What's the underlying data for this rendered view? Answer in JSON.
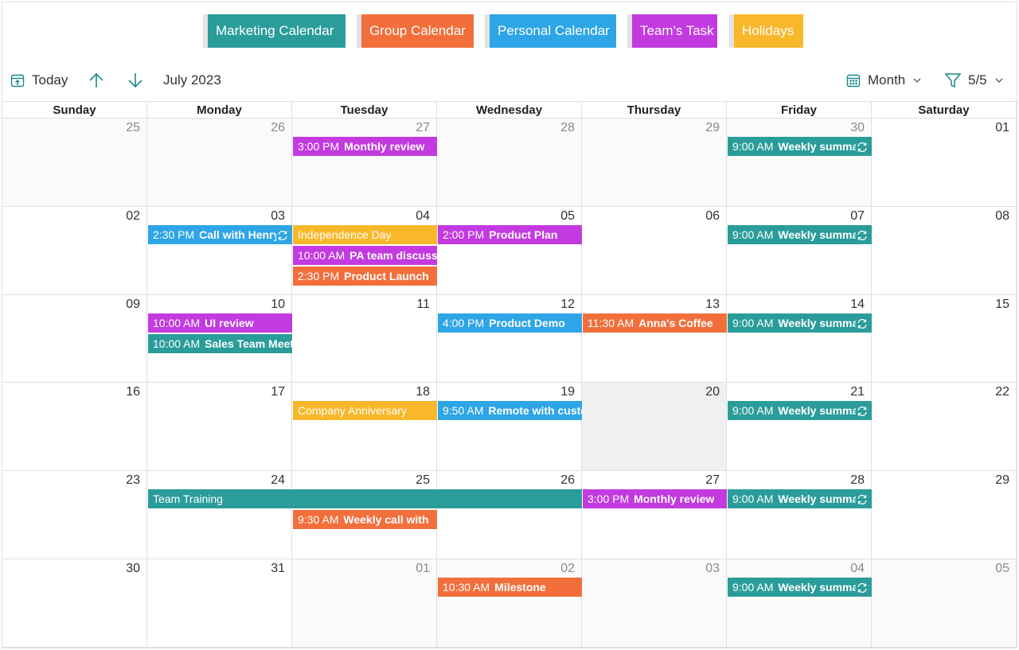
{
  "colors": {
    "marketing": "#2a9d9b",
    "group": "#f26f3c",
    "personal": "#2ea5e6",
    "team": "#c23ae0",
    "holidays": "#f9b72a",
    "accent": "#1a8a86"
  },
  "legend": [
    {
      "label": "Marketing Calendar",
      "color": "#2a9d9b"
    },
    {
      "label": "Group Calendar",
      "color": "#f26f3c"
    },
    {
      "label": "Personal Calendar",
      "color": "#2ea5e6"
    },
    {
      "label": "Team's Task",
      "color": "#c23ae0"
    },
    {
      "label": "Holidays",
      "color": "#f9b72a"
    }
  ],
  "toolbar": {
    "today_label": "Today",
    "period_label": "July 2023",
    "view_label": "Month",
    "filter_label": "5/5"
  },
  "weekdays": [
    "Sunday",
    "Monday",
    "Tuesday",
    "Wednesday",
    "Thursday",
    "Friday",
    "Saturday"
  ],
  "weeks": [
    [
      {
        "d": "25",
        "o": true
      },
      {
        "d": "26",
        "o": true
      },
      {
        "d": "27",
        "o": true
      },
      {
        "d": "28",
        "o": true
      },
      {
        "d": "29",
        "o": true
      },
      {
        "d": "30",
        "o": true
      },
      {
        "d": "01"
      }
    ],
    [
      {
        "d": "02"
      },
      {
        "d": "03"
      },
      {
        "d": "04"
      },
      {
        "d": "05"
      },
      {
        "d": "06"
      },
      {
        "d": "07"
      },
      {
        "d": "08"
      }
    ],
    [
      {
        "d": "09"
      },
      {
        "d": "10"
      },
      {
        "d": "11"
      },
      {
        "d": "12"
      },
      {
        "d": "13"
      },
      {
        "d": "14"
      },
      {
        "d": "15"
      }
    ],
    [
      {
        "d": "16"
      },
      {
        "d": "17"
      },
      {
        "d": "18"
      },
      {
        "d": "19"
      },
      {
        "d": "20",
        "today": true
      },
      {
        "d": "21"
      },
      {
        "d": "22"
      }
    ],
    [
      {
        "d": "23"
      },
      {
        "d": "24"
      },
      {
        "d": "25"
      },
      {
        "d": "26"
      },
      {
        "d": "27"
      },
      {
        "d": "28"
      },
      {
        "d": "29"
      }
    ],
    [
      {
        "d": "30"
      },
      {
        "d": "31"
      },
      {
        "d": "01",
        "o": true
      },
      {
        "d": "02",
        "o": true
      },
      {
        "d": "03",
        "o": true
      },
      {
        "d": "04",
        "o": true
      },
      {
        "d": "05",
        "o": true
      }
    ]
  ],
  "events": [
    {
      "w": 0,
      "c": 2,
      "span": 1,
      "slot": 0,
      "time": "3:00 PM",
      "subject": "Monthly review",
      "cal": "team"
    },
    {
      "w": 0,
      "c": 5,
      "span": 1,
      "slot": 0,
      "time": "9:00 AM",
      "subject": "Weekly summary",
      "cal": "marketing",
      "recurring": true
    },
    {
      "w": 1,
      "c": 1,
      "span": 1,
      "slot": 0,
      "time": "2:30 PM",
      "subject": "Call with Henry",
      "cal": "personal",
      "recurring": true
    },
    {
      "w": 1,
      "c": 2,
      "span": 1,
      "slot": 0,
      "time": "",
      "subject": "Independence Day",
      "cal": "holidays"
    },
    {
      "w": 1,
      "c": 2,
      "span": 1,
      "slot": 1,
      "time": "10:00 AM",
      "subject": "PA team discussion",
      "cal": "team"
    },
    {
      "w": 1,
      "c": 2,
      "span": 1,
      "slot": 2,
      "time": "2:30 PM",
      "subject": "Product Launch",
      "cal": "group"
    },
    {
      "w": 1,
      "c": 3,
      "span": 1,
      "slot": 0,
      "time": "2:00 PM",
      "subject": "Product Plan",
      "cal": "team"
    },
    {
      "w": 1,
      "c": 5,
      "span": 1,
      "slot": 0,
      "time": "9:00 AM",
      "subject": "Weekly summary",
      "cal": "marketing",
      "recurring": true
    },
    {
      "w": 2,
      "c": 1,
      "span": 1,
      "slot": 0,
      "time": "10:00 AM",
      "subject": "UI review",
      "cal": "team"
    },
    {
      "w": 2,
      "c": 1,
      "span": 1,
      "slot": 1,
      "time": "10:00 AM",
      "subject": "Sales Team Meeting",
      "cal": "marketing"
    },
    {
      "w": 2,
      "c": 3,
      "span": 1,
      "slot": 0,
      "time": "4:00 PM",
      "subject": "Product Demo",
      "cal": "personal"
    },
    {
      "w": 2,
      "c": 4,
      "span": 1,
      "slot": 0,
      "time": "11:30 AM",
      "subject": "Anna's Coffee",
      "cal": "group"
    },
    {
      "w": 2,
      "c": 5,
      "span": 1,
      "slot": 0,
      "time": "9:00 AM",
      "subject": "Weekly summary",
      "cal": "marketing",
      "recurring": true
    },
    {
      "w": 3,
      "c": 2,
      "span": 1,
      "slot": 0,
      "time": "",
      "subject": "Company Anniversary",
      "cal": "holidays"
    },
    {
      "w": 3,
      "c": 3,
      "span": 1,
      "slot": 0,
      "time": "9:50 AM",
      "subject": "Remote with customer",
      "cal": "personal"
    },
    {
      "w": 3,
      "c": 5,
      "span": 1,
      "slot": 0,
      "time": "9:00 AM",
      "subject": "Weekly summary",
      "cal": "marketing",
      "recurring": true
    },
    {
      "w": 4,
      "c": 1,
      "span": 3,
      "slot": 0,
      "time": "",
      "subject": "Team Training",
      "cal": "marketing"
    },
    {
      "w": 4,
      "c": 2,
      "span": 1,
      "slot": 1,
      "time": "9:30 AM",
      "subject": "Weekly call with",
      "cal": "group"
    },
    {
      "w": 4,
      "c": 4,
      "span": 1,
      "slot": 0,
      "time": "3:00 PM",
      "subject": "Monthly review",
      "cal": "team"
    },
    {
      "w": 4,
      "c": 5,
      "span": 1,
      "slot": 0,
      "time": "9:00 AM",
      "subject": "Weekly summary",
      "cal": "marketing",
      "recurring": true
    },
    {
      "w": 5,
      "c": 3,
      "span": 1,
      "slot": 0,
      "time": "10:30 AM",
      "subject": "Milestone",
      "cal": "group"
    },
    {
      "w": 5,
      "c": 5,
      "span": 1,
      "slot": 0,
      "time": "9:00 AM",
      "subject": "Weekly summary",
      "cal": "marketing",
      "recurring": true
    }
  ]
}
